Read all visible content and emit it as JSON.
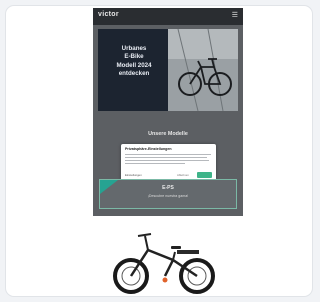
{
  "colors": {
    "frame_bg": "#f1f3f6",
    "card_bg": "#ffffff",
    "page_overlay": "#5c5f63",
    "hero_bg": "#1c2430",
    "accent": "#3eb489",
    "teal": "#26a392"
  },
  "site": {
    "brand": "victor",
    "menu_icon": "hamburger-icon"
  },
  "hero": {
    "headline": "Urbanes\nE-Bike\nModell 2024\nentdecken"
  },
  "section": {
    "title": "Unsere Modelle"
  },
  "cookie_modal": {
    "title": "Privatsphäre-Einstellungen",
    "decline_label": "Einstellungen",
    "more_label": "Ablehnen",
    "accept_label": ""
  },
  "promo": {
    "title": "E-PS",
    "subtitle": "¡Descubre nuestra gama!"
  },
  "product": {
    "image": "cargo-ebike"
  }
}
